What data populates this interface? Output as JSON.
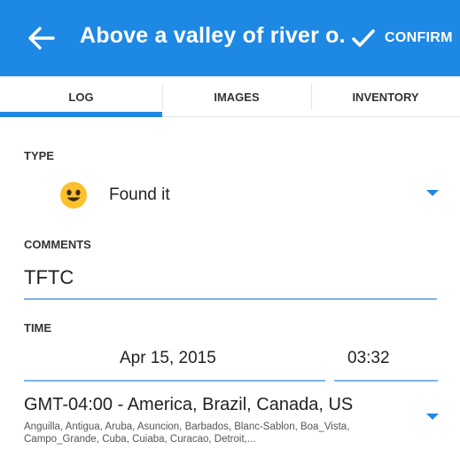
{
  "appbar": {
    "title": "Above a valley of river o...",
    "confirm_label": "CONFIRM",
    "color": "#1e88e5"
  },
  "tabs": [
    {
      "label": "LOG",
      "selected": true
    },
    {
      "label": "IMAGES",
      "selected": false
    },
    {
      "label": "INVENTORY",
      "selected": false
    }
  ],
  "form": {
    "type": {
      "label": "TYPE",
      "value": "Found it",
      "icon": "smiley-icon"
    },
    "comments": {
      "label": "COMMENTS",
      "value": "TFTC"
    },
    "time": {
      "label": "TIME",
      "date": "Apr 15, 2015",
      "time": "03:32"
    },
    "timezone": {
      "main": "GMT-04:00 - America, Brazil, Canada, US",
      "cities": "Anguilla, Antigua, Aruba, Asuncion, Barbados, Blanc-Sablon, Boa_Vista, Campo_Grande, Cuba, Cuiaba, Curacao, Detroit,..."
    }
  }
}
